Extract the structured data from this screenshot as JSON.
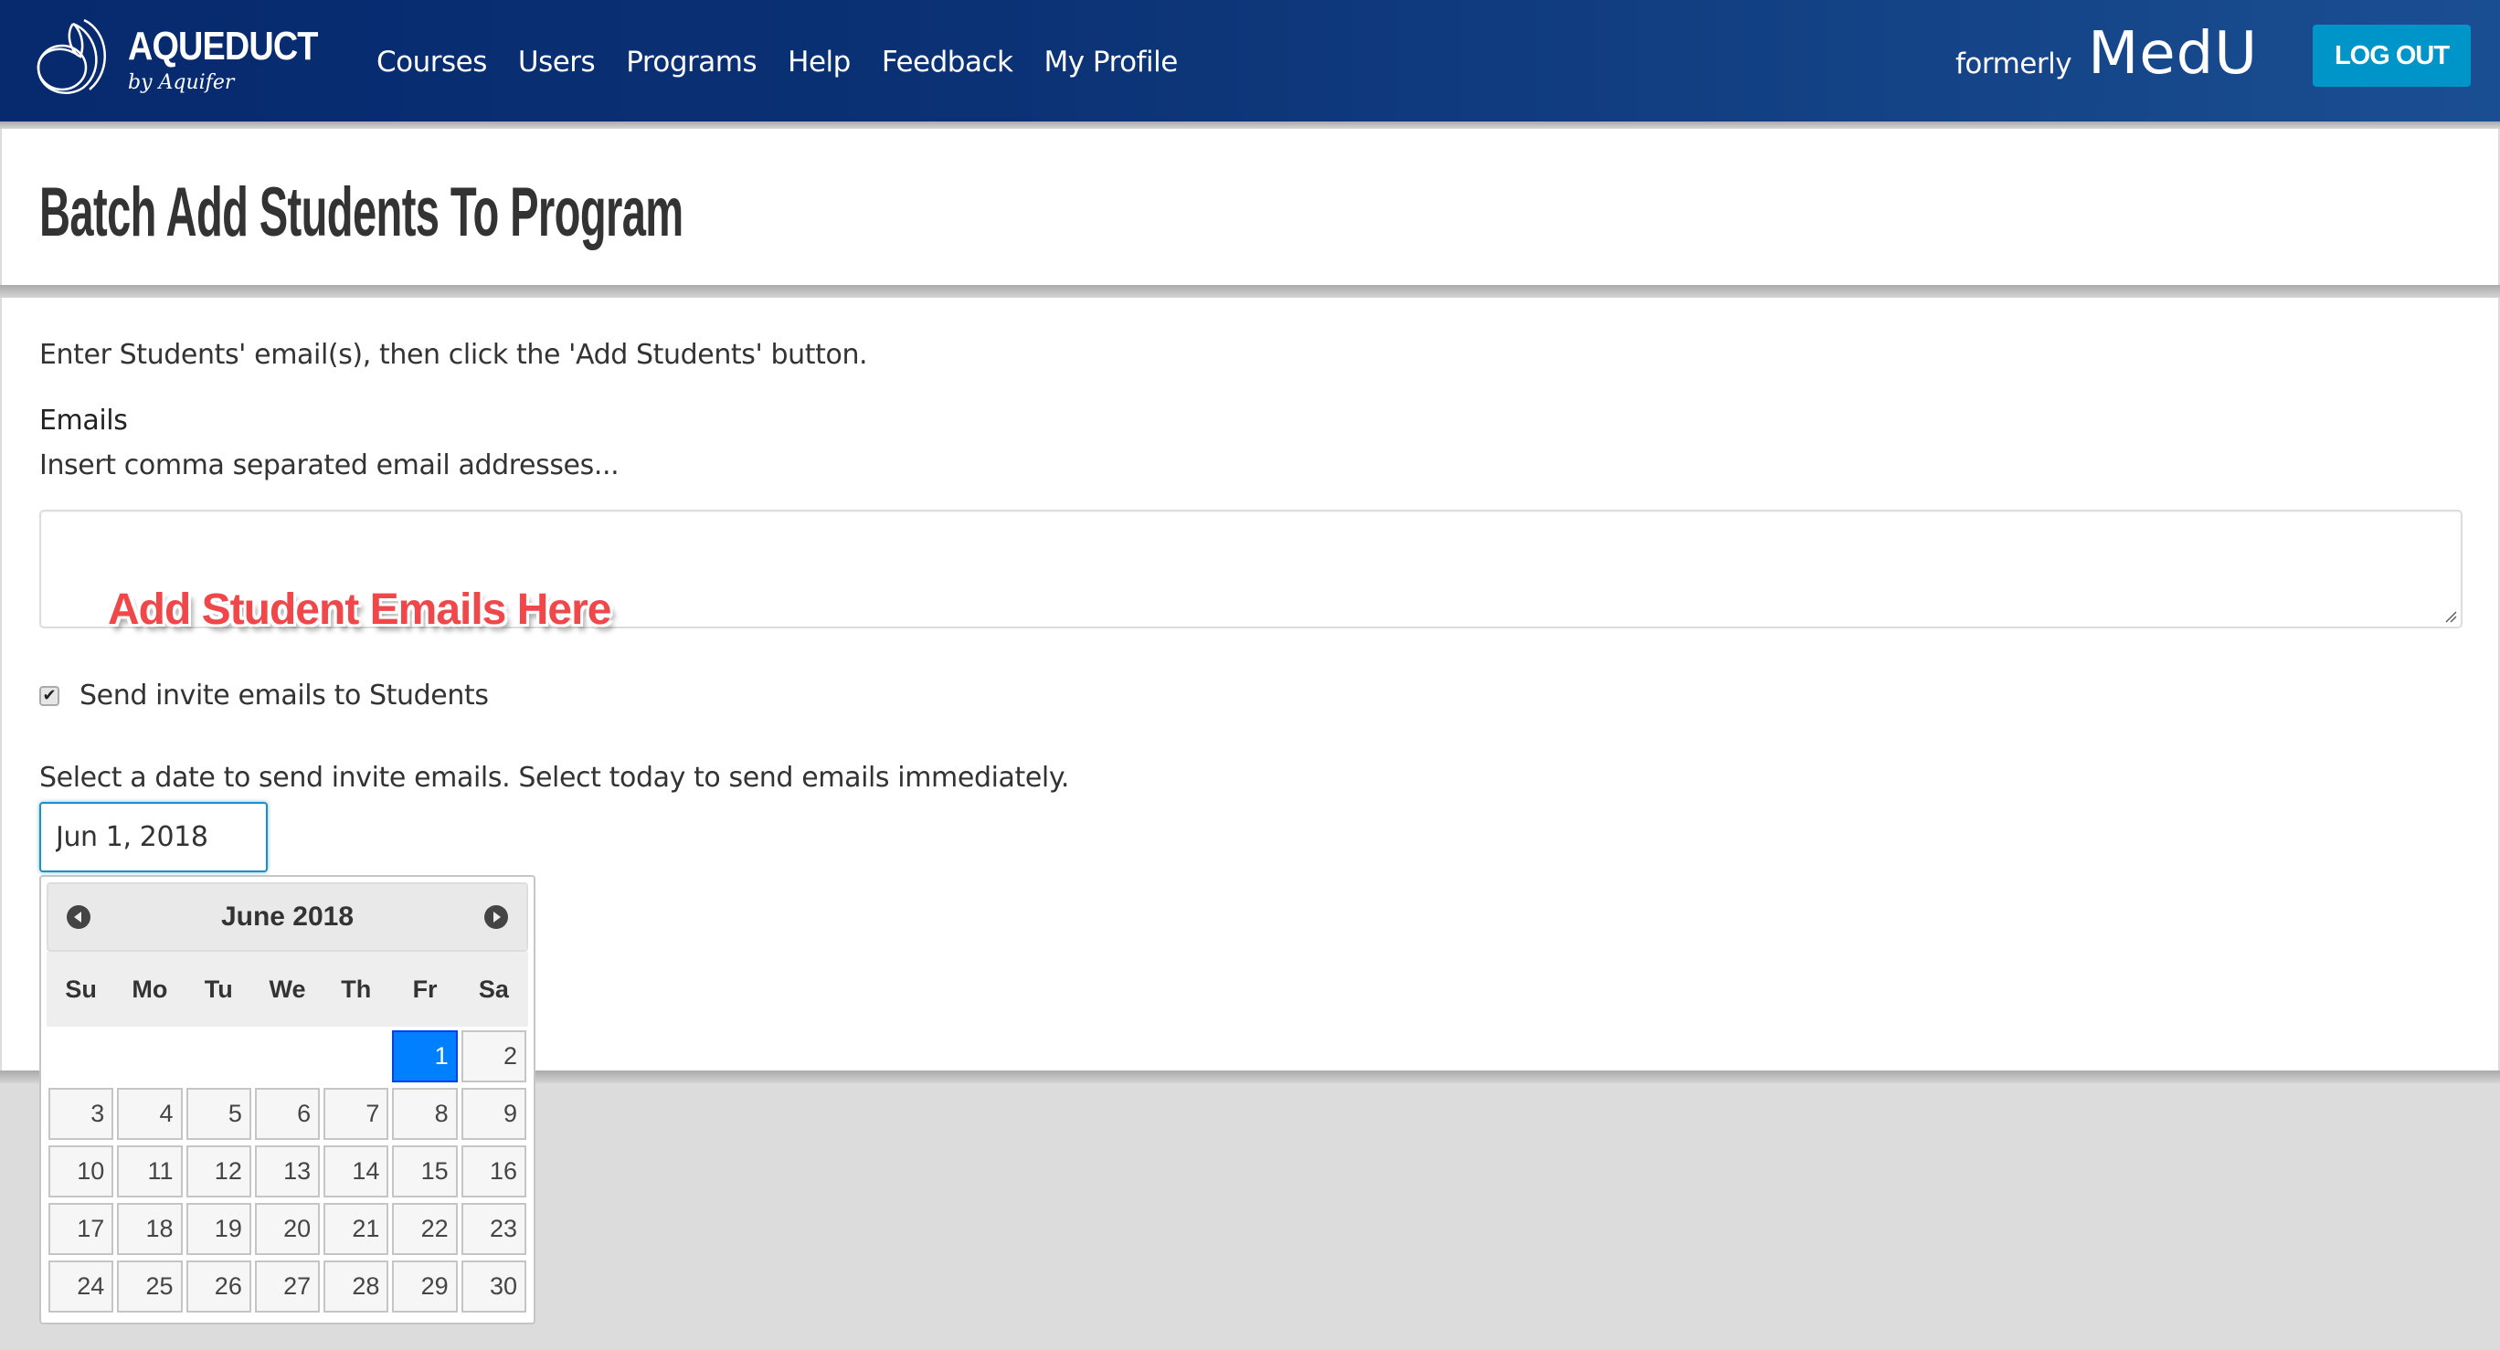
{
  "navbar": {
    "logo_title": "AQUEDUCT",
    "logo_subtitle": "by Aquifer",
    "links": [
      "Courses",
      "Users",
      "Programs",
      "Help",
      "Feedback",
      "My Profile"
    ],
    "brand_formerly": "formerly",
    "brand_name": "MedU",
    "logout_label": "LOG OUT"
  },
  "page": {
    "title": "Batch Add Students To Program"
  },
  "form": {
    "intro": "Enter Students' email(s), then click the 'Add Students' button.",
    "emails_label": "Emails",
    "emails_help": "Insert comma separated email addresses...",
    "emails_value": "",
    "annotation": "Add Student Emails Here",
    "send_invites_label": "Send invite emails to Students",
    "send_invites_checked": true,
    "date_label": "Select a date to send invite emails. Select today to send emails immediately.",
    "date_value": "Jun 1, 2018"
  },
  "datepicker": {
    "month_title": "June 2018",
    "weekdays": [
      "Su",
      "Mo",
      "Tu",
      "We",
      "Th",
      "Fr",
      "Sa"
    ],
    "leading_blanks": 5,
    "days": [
      "1",
      "2",
      "3",
      "4",
      "5",
      "6",
      "7",
      "8",
      "9",
      "10",
      "11",
      "12",
      "13",
      "14",
      "15",
      "16",
      "17",
      "18",
      "19",
      "20",
      "21",
      "22",
      "23",
      "24",
      "25",
      "26",
      "27",
      "28",
      "29",
      "30"
    ],
    "selected_day": "1",
    "colors": {
      "selected_bg": "#007fff",
      "selected_border": "#003eff"
    }
  },
  "colors": {
    "nav_start": "#07296e",
    "nav_end": "#1a4e92",
    "logout_bg": "#0095c9",
    "annotation": "#f0474a"
  }
}
